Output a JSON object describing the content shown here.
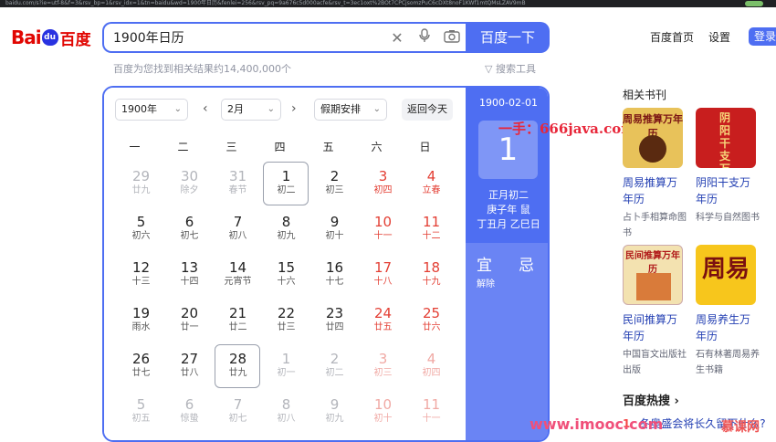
{
  "browser": {
    "url": "baidu.com/s?ie=utf-8&f=3&rsv_bp=1&rsv_idx=1&tn=baidu&wd=1900年日历&fenlei=256&rsv_pq=9a676c5d000acfe&rsv_t=3ec1oxt%2BOt7CPCjsomzPuC6cDXt8noF1KWf1mtQMsLZAV9mB"
  },
  "header": {
    "logo_latin": "Bai",
    "logo_paw": "du",
    "logo_cn": "百度",
    "query": "1900年日历",
    "search_button": "百度一下",
    "link_home": "百度首页",
    "link_settings": "设置",
    "link_login": "登录",
    "result_count": "百度为您找到相关结果约14,400,000个",
    "search_tools": "搜索工具"
  },
  "calendar": {
    "year_select": "1900年",
    "month_select": "2月",
    "holiday_select": "假期安排",
    "today_button": "返回今天",
    "weekdays": [
      "一",
      "二",
      "三",
      "四",
      "五",
      "六",
      "日"
    ],
    "cells": [
      {
        "d": "29",
        "l": "廿九",
        "dim": true,
        "wk": false
      },
      {
        "d": "30",
        "l": "除夕",
        "dim": true,
        "wk": false
      },
      {
        "d": "31",
        "l": "春节",
        "dim": true,
        "wk": false
      },
      {
        "d": "1",
        "l": "初二",
        "dim": false,
        "wk": false,
        "today": true
      },
      {
        "d": "2",
        "l": "初三",
        "dim": false,
        "wk": false
      },
      {
        "d": "3",
        "l": "初四",
        "dim": false,
        "wk": true
      },
      {
        "d": "4",
        "l": "立春",
        "dim": false,
        "wk": true
      },
      {
        "d": "5",
        "l": "初六",
        "dim": false,
        "wk": false
      },
      {
        "d": "6",
        "l": "初七",
        "dim": false,
        "wk": false
      },
      {
        "d": "7",
        "l": "初八",
        "dim": false,
        "wk": false
      },
      {
        "d": "8",
        "l": "初九",
        "dim": false,
        "wk": false
      },
      {
        "d": "9",
        "l": "初十",
        "dim": false,
        "wk": false
      },
      {
        "d": "10",
        "l": "十一",
        "dim": false,
        "wk": true
      },
      {
        "d": "11",
        "l": "十二",
        "dim": false,
        "wk": true
      },
      {
        "d": "12",
        "l": "十三",
        "dim": false,
        "wk": false
      },
      {
        "d": "13",
        "l": "十四",
        "dim": false,
        "wk": false
      },
      {
        "d": "14",
        "l": "元宵节",
        "dim": false,
        "wk": false
      },
      {
        "d": "15",
        "l": "十六",
        "dim": false,
        "wk": false
      },
      {
        "d": "16",
        "l": "十七",
        "dim": false,
        "wk": false
      },
      {
        "d": "17",
        "l": "十八",
        "dim": false,
        "wk": true
      },
      {
        "d": "18",
        "l": "十九",
        "dim": false,
        "wk": true
      },
      {
        "d": "19",
        "l": "雨水",
        "dim": false,
        "wk": false
      },
      {
        "d": "20",
        "l": "廿一",
        "dim": false,
        "wk": false
      },
      {
        "d": "21",
        "l": "廿二",
        "dim": false,
        "wk": false
      },
      {
        "d": "22",
        "l": "廿三",
        "dim": false,
        "wk": false
      },
      {
        "d": "23",
        "l": "廿四",
        "dim": false,
        "wk": false
      },
      {
        "d": "24",
        "l": "廿五",
        "dim": false,
        "wk": true
      },
      {
        "d": "25",
        "l": "廿六",
        "dim": false,
        "wk": true
      },
      {
        "d": "26",
        "l": "廿七",
        "dim": false,
        "wk": false
      },
      {
        "d": "27",
        "l": "廿八",
        "dim": false,
        "wk": false
      },
      {
        "d": "28",
        "l": "廿九",
        "dim": false,
        "wk": false,
        "today": true
      },
      {
        "d": "1",
        "l": "初一",
        "dim": true,
        "wk": false
      },
      {
        "d": "2",
        "l": "初二",
        "dim": true,
        "wk": false
      },
      {
        "d": "3",
        "l": "初三",
        "dim": true,
        "wk": true
      },
      {
        "d": "4",
        "l": "初四",
        "dim": true,
        "wk": true
      },
      {
        "d": "5",
        "l": "初五",
        "dim": true,
        "wk": false
      },
      {
        "d": "6",
        "l": "惊蛰",
        "dim": true,
        "wk": false
      },
      {
        "d": "7",
        "l": "初七",
        "dim": true,
        "wk": false
      },
      {
        "d": "8",
        "l": "初八",
        "dim": true,
        "wk": false
      },
      {
        "d": "9",
        "l": "初九",
        "dim": true,
        "wk": false
      },
      {
        "d": "10",
        "l": "初十",
        "dim": true,
        "wk": true
      },
      {
        "d": "11",
        "l": "十一",
        "dim": true,
        "wk": true
      }
    ],
    "side": {
      "date": "1900-02-01",
      "day": "1",
      "lunar_line1": "正月初二",
      "lunar_line2": "庚子年 鼠",
      "lunar_line3": "丁丑月 乙巳日",
      "yi": "宜",
      "ji": "忌",
      "yi_items": "解除"
    }
  },
  "related_books": {
    "title": "相关书刊",
    "books": [
      {
        "cover": "周易推算万年历",
        "name": "周易推算万年历",
        "sub": "占卜手相算命图书"
      },
      {
        "cover": "阴阳干支万",
        "name": "阴阳干支万年历",
        "sub": "科学与自然图书"
      },
      {
        "cover": "民间推算万年历",
        "name": "民间推算万年历",
        "sub": "中国盲文出版社出版"
      },
      {
        "cover": "周易",
        "name": "周易养生万年历",
        "sub": "石有林著周易养生书籍"
      }
    ]
  },
  "hot": {
    "title": "百度热搜",
    "item_rank": "1",
    "item_text": "冬奥盛会将长久留下什么?"
  },
  "watermarks": {
    "w1": "一手：666java.com",
    "w2": "www.imooc.com",
    "w3": "慕课网"
  }
}
